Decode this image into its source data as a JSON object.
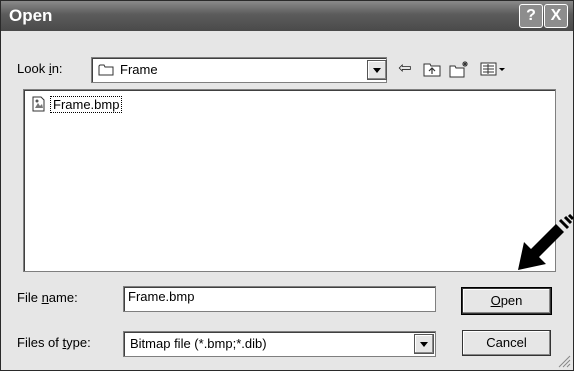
{
  "window": {
    "title": "Open"
  },
  "titlebar": {
    "help_label": "?",
    "close_label": "X"
  },
  "lookin": {
    "label_pre": "Look ",
    "label_accel": "i",
    "label_post": "n:",
    "value": "Frame"
  },
  "toolbar": {
    "back_glyph": "⇦",
    "up_glyph": "⇧",
    "newfolder_glyph": "✳",
    "view_glyph": "▦"
  },
  "files": [
    {
      "name": "Frame.bmp",
      "icon": "bitmap-file-icon"
    }
  ],
  "filename": {
    "label_pre": "File ",
    "label_accel": "n",
    "label_post": "ame:",
    "value": "Frame.bmp"
  },
  "filetype": {
    "label_pre": "Files of ",
    "label_accel": "t",
    "label_post": "ype:",
    "value": "Bitmap file (*.bmp;*.dib)"
  },
  "buttons": {
    "open_accel": "O",
    "open_rest": "pen",
    "cancel": "Cancel"
  },
  "colors": {
    "titlebar": "#5b5b5b",
    "dialog_bg": "#e6e6e6",
    "field_bg": "#ffffff"
  }
}
